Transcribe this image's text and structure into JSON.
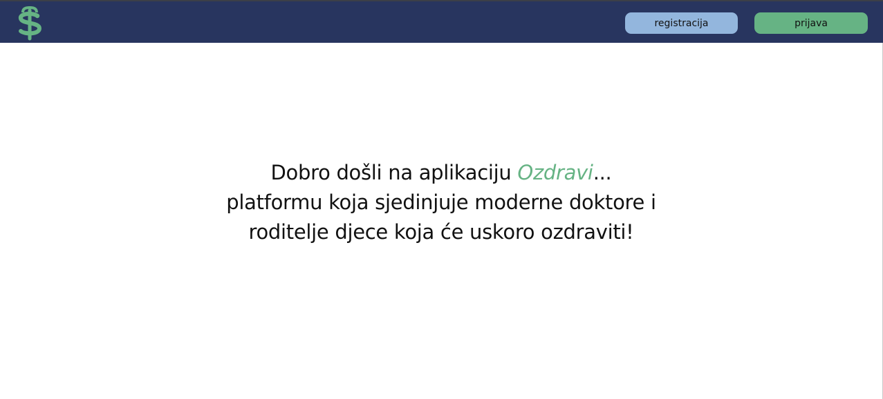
{
  "header": {
    "logo_icon": "caduceus-dollar-icon",
    "register_label": "registracija",
    "login_label": "prijava"
  },
  "welcome": {
    "line1_prefix": "Dobro došli na aplikaciju ",
    "app_name": "Ozdravi",
    "line1_suffix": "...",
    "line2": "platformu koja sjedinjuje moderne doktore i",
    "line3": "roditelje djece koja će uskoro ozdraviti!"
  },
  "colors": {
    "header_bg": "#28355f",
    "register_button": "#93b6dd",
    "login_button": "#66b384",
    "accent": "#66b384",
    "text": "#111111"
  }
}
